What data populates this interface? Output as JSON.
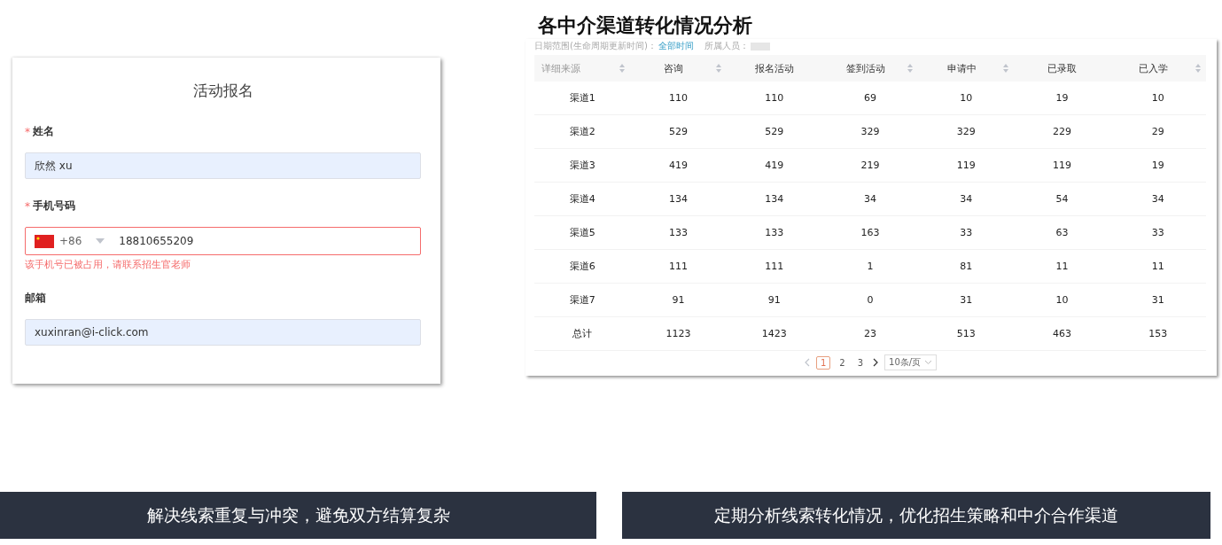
{
  "signup_form": {
    "title": "活动报名",
    "fields": [
      {
        "kind": "text",
        "label": "姓名",
        "required_mark": "*",
        "value": "欣然 xu"
      },
      {
        "kind": "phone",
        "label": "手机号码",
        "required_mark": "*",
        "country_code": "+86",
        "value": "18810655209",
        "error": "该手机号已被占用，请联系招生官老师"
      },
      {
        "kind": "text",
        "label": "邮箱",
        "value": "xuxinran@i-click.com"
      }
    ]
  },
  "report": {
    "title": "各中介渠道转化情况分析",
    "filters": [
      {
        "label": "日期范围(生命周期更新时间)：",
        "value": "全部时间"
      },
      {
        "label": "所属人员：",
        "redacted": true
      }
    ],
    "columns": [
      {
        "label": "详细来源",
        "sortable": true
      },
      {
        "label": "咨询",
        "sortable": true
      },
      {
        "label": "报名活动",
        "sortable": false
      },
      {
        "label": "签到活动",
        "sortable": true
      },
      {
        "label": "申请中",
        "sortable": true
      },
      {
        "label": "已录取",
        "sortable": false
      },
      {
        "label": "已入学",
        "sortable": true
      }
    ],
    "rows": [
      [
        "渠道1",
        "110",
        "110",
        "69",
        "10",
        "19",
        "10"
      ],
      [
        "渠道2",
        "529",
        "529",
        "329",
        "329",
        "229",
        "29"
      ],
      [
        "渠道3",
        "419",
        "419",
        "219",
        "119",
        "119",
        "19"
      ],
      [
        "渠道4",
        "134",
        "134",
        "34",
        "34",
        "54",
        "34"
      ],
      [
        "渠道5",
        "133",
        "133",
        "163",
        "33",
        "63",
        "33"
      ],
      [
        "渠道6",
        "111",
        "111",
        "1",
        "81",
        "11",
        "11"
      ],
      [
        "渠道7",
        "91",
        "91",
        "0",
        "31",
        "10",
        "31"
      ],
      [
        "总计",
        "1123",
        "1423",
        "23",
        "513",
        "463",
        "153"
      ]
    ],
    "pagination": {
      "pages": [
        {
          "label": "1",
          "selected": true
        },
        {
          "label": "2",
          "selected": false
        },
        {
          "label": "3",
          "selected": false
        }
      ],
      "page_size": "10条/页"
    }
  },
  "captions": [
    "解决线索重复与冲突，避免双方结算复杂",
    "定期分析线索转化情况，优化招生策略和中介合作渠道"
  ]
}
